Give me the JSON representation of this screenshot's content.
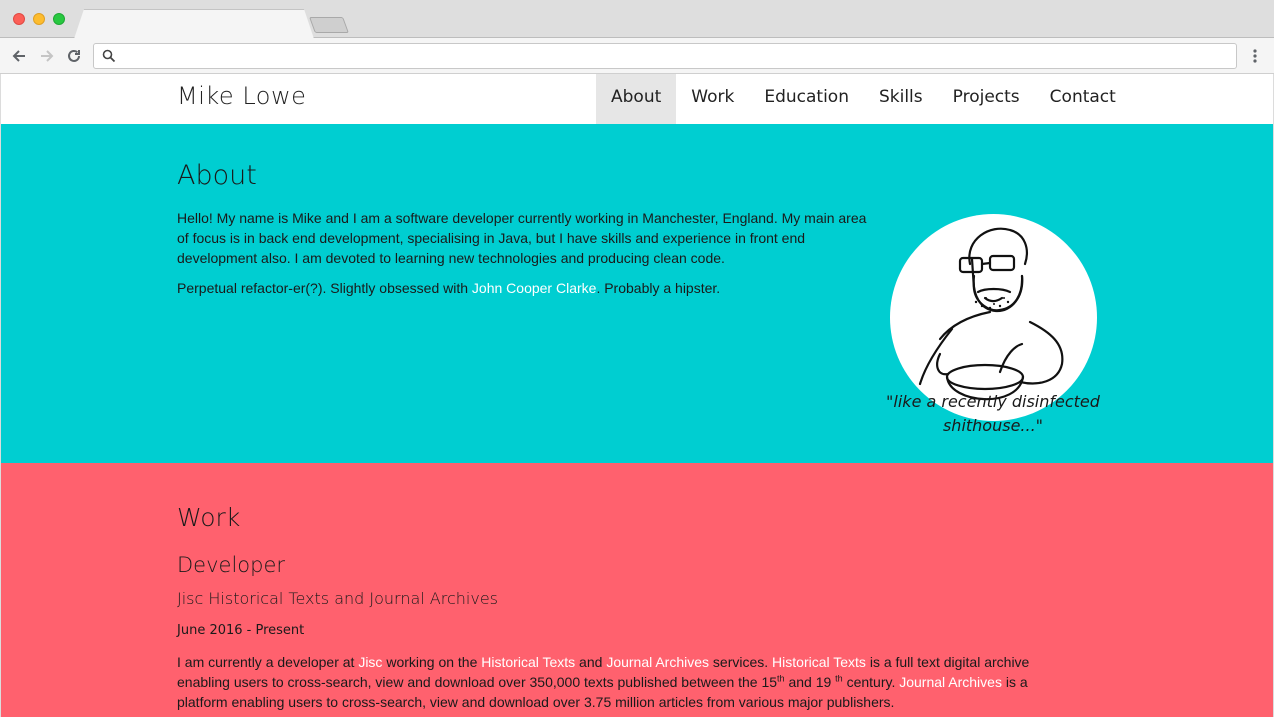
{
  "site": {
    "brand": "Mike Lowe",
    "nav": [
      "About",
      "Work",
      "Education",
      "Skills",
      "Projects",
      "Contact"
    ],
    "active_nav": "About"
  },
  "about": {
    "heading": "About",
    "para1": "Hello! My name is Mike and I am a software developer currently working in Manchester, England. My main area of focus is in back end development, specialising in Java, but I have skills and experience in front end development also. I am devoted to learning new technologies and producing clean code.",
    "para2_before": "Perpetual refactor-er(?). Slightly obsessed with ",
    "para2_link": "John Cooper Clarke",
    "para2_after": ". Probably a hipster.",
    "quote": "\"like a recently disinfected shithouse...\""
  },
  "work": {
    "heading": "Work",
    "role": "Developer",
    "company": "Jisc Historical Texts and Journal Archives",
    "dates": "June 2016 - Present",
    "desc_parts": [
      "I am currently a developer at ",
      "Jisc",
      " working on the ",
      "Historical Texts",
      " and ",
      "Journal Archives",
      " services. ",
      "Historical Texts",
      " is a full text digital archive enabling users to cross-search, view and download over 350,000 texts published between the 15",
      "th",
      " and 19 ",
      "th",
      " century. ",
      "Journal Archives",
      " is a platform enabling users to cross-search, view and download over 3.75 million articles from various major publishers."
    ]
  },
  "colors": {
    "about_bg": "#00ced1",
    "work_bg": "#ff616e",
    "link": "#ffffff"
  }
}
